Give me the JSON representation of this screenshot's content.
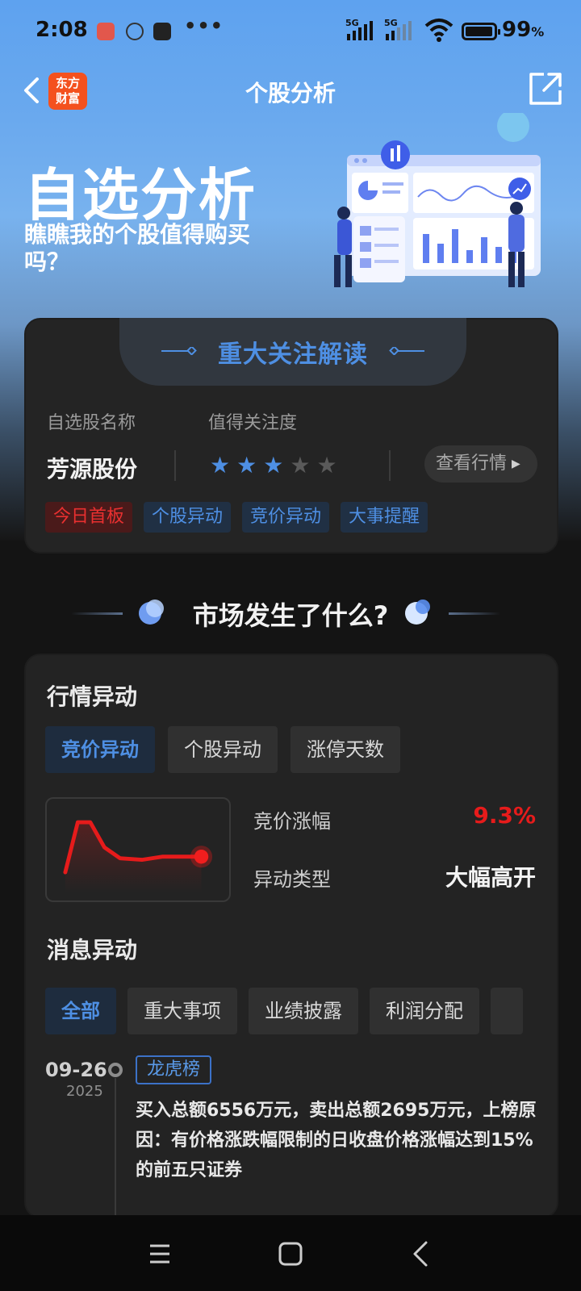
{
  "status_bar": {
    "time": "2:08",
    "more": "•••",
    "net1": "5G",
    "net2": "5G",
    "battery": "99",
    "battery_unit": "%"
  },
  "nav": {
    "logo_line1": "东方",
    "logo_line2": "财富",
    "title": "个股分析"
  },
  "hero": {
    "title": "自选分析",
    "subtitle": "瞧瞧我的个股值得购买吗？"
  },
  "focus_card": {
    "title": "重大关注解读",
    "name_label": "自选股名称",
    "rating_label": "值得关注度",
    "stock_name": "芳源股份",
    "rating": 3,
    "rating_max": 5,
    "view_button": "查看行情",
    "tags": [
      {
        "label": "今日首板",
        "color": "red"
      },
      {
        "label": "个股异动",
        "color": "blue"
      },
      {
        "label": "竞价异动",
        "color": "blue"
      },
      {
        "label": "大事提醒",
        "color": "blue"
      }
    ]
  },
  "market_section": {
    "heading": "市场发生了什么?"
  },
  "market_card": {
    "quote_title": "行情异动",
    "quote_tabs": [
      "竞价异动",
      "个股异动",
      "涨停天数"
    ],
    "active_quote_tab": 0,
    "auction_change_label": "竞价涨幅",
    "auction_change_value": "9.3%",
    "move_type_label": "异动类型",
    "move_type_value": "大幅高开",
    "news_title": "消息异动",
    "news_tabs": [
      "全部",
      "重大事项",
      "业绩披露",
      "利润分配"
    ],
    "active_news_tab": 0,
    "timeline": [
      {
        "date": "09-26",
        "year": "2025",
        "tag": "龙虎榜",
        "text": "买入总额6556万元，卖出总额2695万元，上榜原因：有价格涨跌幅限制的日收盘价格涨幅达到15%的前五只证券"
      }
    ]
  },
  "colors": {
    "accent_blue": "#4e8fe3",
    "up_red": "#e61b1b",
    "logo_orange": "#f4511e"
  }
}
